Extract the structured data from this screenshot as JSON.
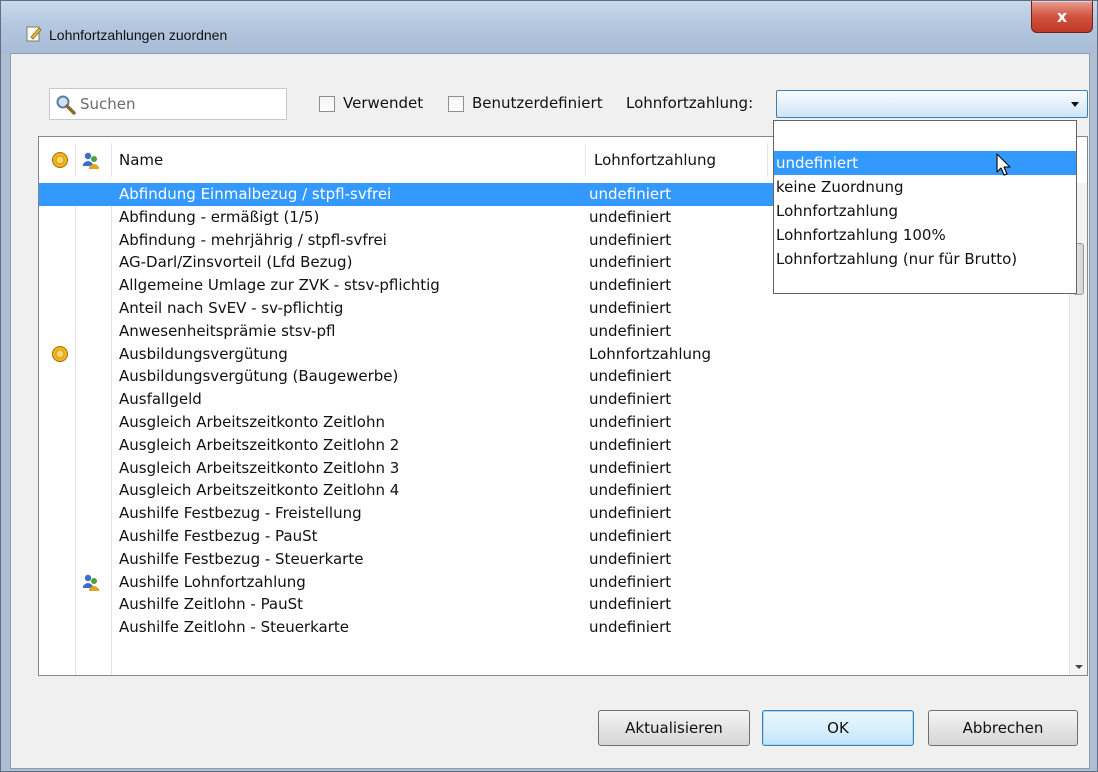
{
  "window": {
    "title": "Lohnfortzahlungen zuordnen",
    "close_glyph": "x"
  },
  "toolbar": {
    "search_placeholder": "Suchen",
    "verwendet_label": "Verwendet",
    "benutzerdefiniert_label": "Benutzerdefiniert",
    "filter_label": "Lohnfortzahlung:",
    "filter_value": ""
  },
  "dropdown": {
    "options": [
      "",
      "undefiniert",
      "keine Zuordnung",
      "Lohnfortzahlung",
      "Lohnfortzahlung 100%",
      "Lohnfortzahlung (nur für Brutto)"
    ],
    "selected_index": 1
  },
  "table": {
    "columns": [
      "Name",
      "Lohnfortzahlung"
    ],
    "rows": [
      {
        "name": "Abfindung Einmalbezug / stpfl-svfrei",
        "lfz": "undefiniert",
        "icon": "",
        "selected": true
      },
      {
        "name": "Abfindung - ermäßigt (1/5)",
        "lfz": "undefiniert",
        "icon": ""
      },
      {
        "name": "Abfindung - mehrjährig / stpfl-svfrei",
        "lfz": "undefiniert",
        "icon": ""
      },
      {
        "name": "AG-Darl/Zinsvorteil (Lfd Bezug)",
        "lfz": "undefiniert",
        "icon": ""
      },
      {
        "name": "Allgemeine Umlage zur ZVK - stsv-pflichtig",
        "lfz": "undefiniert",
        "icon": ""
      },
      {
        "name": "Anteil nach SvEV - sv-pflichtig",
        "lfz": "undefiniert",
        "icon": ""
      },
      {
        "name": "Anwesenheitsprämie stsv-pfl",
        "lfz": "undefiniert",
        "icon": ""
      },
      {
        "name": "Ausbildungsvergütung",
        "lfz": "Lohnfortzahlung",
        "icon": "coin-icon"
      },
      {
        "name": "Ausbildungsvergütung (Baugewerbe)",
        "lfz": "undefiniert",
        "icon": ""
      },
      {
        "name": "Ausfallgeld",
        "lfz": "undefiniert",
        "icon": ""
      },
      {
        "name": "Ausgleich Arbeitszeitkonto Zeitlohn",
        "lfz": "undefiniert",
        "icon": ""
      },
      {
        "name": "Ausgleich Arbeitszeitkonto Zeitlohn 2",
        "lfz": "undefiniert",
        "icon": ""
      },
      {
        "name": "Ausgleich Arbeitszeitkonto Zeitlohn 3",
        "lfz": "undefiniert",
        "icon": ""
      },
      {
        "name": "Ausgleich Arbeitszeitkonto Zeitlohn 4",
        "lfz": "undefiniert",
        "icon": ""
      },
      {
        "name": "Aushilfe Festbezug - Freistellung",
        "lfz": "undefiniert",
        "icon": ""
      },
      {
        "name": "Aushilfe Festbezug - PauSt",
        "lfz": "undefiniert",
        "icon": ""
      },
      {
        "name": "Aushilfe Festbezug - Steuerkarte",
        "lfz": "undefiniert",
        "icon": ""
      },
      {
        "name": "Aushilfe Lohnfortzahlung",
        "lfz": "undefiniert",
        "icon": "users-icon"
      },
      {
        "name": "Aushilfe Zeitlohn - PauSt",
        "lfz": "undefiniert",
        "icon": ""
      },
      {
        "name": "Aushilfe Zeitlohn - Steuerkarte",
        "lfz": "undefiniert",
        "icon": ""
      }
    ]
  },
  "buttons": {
    "refresh": "Aktualisieren",
    "ok": "OK",
    "cancel": "Abbrechen"
  },
  "colors": {
    "selection": "#3399ff",
    "accent_border": "#3c7fb1"
  }
}
